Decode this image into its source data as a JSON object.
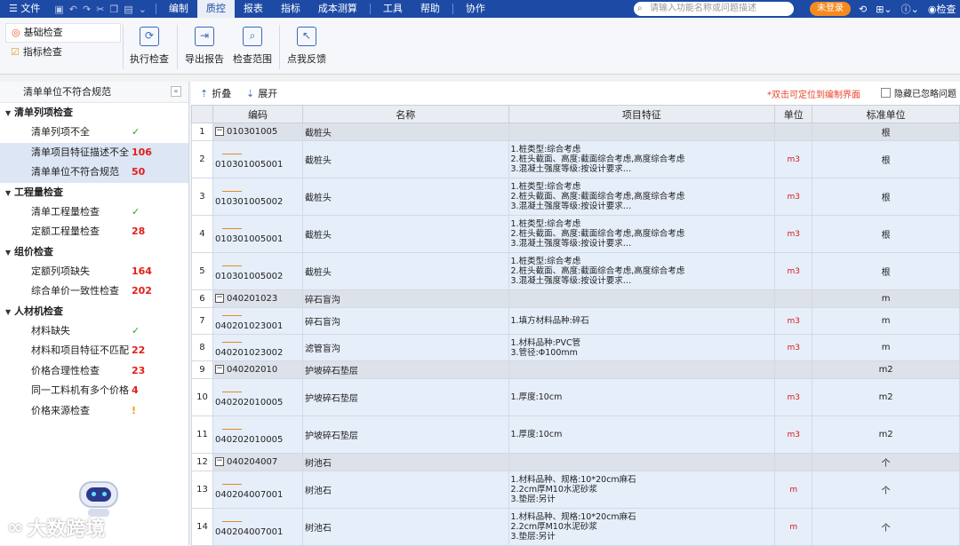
{
  "menu": {
    "file": "文件",
    "edit": "编制",
    "qc": "质控",
    "report": "报表",
    "index": "指标",
    "cost": "成本测算",
    "tools": "工具",
    "help": "帮助",
    "collab": "协作"
  },
  "search": {
    "placeholder": "请输入功能名称或问题描述"
  },
  "login": "未登录",
  "right_tool": "检查",
  "ribbon": {
    "tabs": [
      "基础检查",
      "指标检查"
    ],
    "buttons": [
      "执行检查",
      "导出报告",
      "检查范围",
      "点我反馈"
    ]
  },
  "left": {
    "header": "清单单位不符合规范",
    "groups": [
      {
        "title": "清单列项检查",
        "items": [
          {
            "label": "清单列项不全",
            "value": "✓",
            "type": "ok"
          },
          {
            "label": "清单项目特征描述不全",
            "value": "106",
            "type": "err"
          },
          {
            "label": "清单单位不符合规范",
            "value": "50",
            "type": "err"
          }
        ]
      },
      {
        "title": "工程量检查",
        "items": [
          {
            "label": "清单工程量检查",
            "value": "✓",
            "type": "ok"
          },
          {
            "label": "定额工程量检查",
            "value": "28",
            "type": "err"
          }
        ]
      },
      {
        "title": "组价检查",
        "items": [
          {
            "label": "定额列项缺失",
            "value": "164",
            "type": "err"
          },
          {
            "label": "综合单价一致性检查",
            "value": "202",
            "type": "err"
          }
        ]
      },
      {
        "title": "人材机检查",
        "items": [
          {
            "label": "材料缺失",
            "value": "✓",
            "type": "ok"
          },
          {
            "label": "材料和项目特征不匹配",
            "value": "22",
            "type": "err"
          },
          {
            "label": "价格合理性检查",
            "value": "23",
            "type": "err"
          },
          {
            "label": "同一工料机有多个价格",
            "value": "4",
            "type": "err"
          },
          {
            "label": "价格来源检查",
            "value": "!",
            "type": "warn"
          }
        ]
      }
    ]
  },
  "watermark": "大数跨境",
  "toolbar": {
    "fold": "折叠",
    "expand": "展开",
    "hint": "*双击可定位到编制界面",
    "hide": "隐藏已忽略问题"
  },
  "table": {
    "headers": [
      "编码",
      "名称",
      "项目特征",
      "单位",
      "标准单位"
    ],
    "rows": [
      {
        "n": "1",
        "kind": "parent",
        "code": "010301005",
        "name": "截桩头",
        "feat": "",
        "unit": "",
        "std": "根"
      },
      {
        "n": "2",
        "kind": "child",
        "code": "010301005001",
        "name": "截桩头",
        "feat": "1.桩类型:综合考虑\n2.桩头截面、高度:截面综合考虑,高度综合考虑\n3.混凝土强度等级:按设计要求…",
        "unit": "m3",
        "std": "根"
      },
      {
        "n": "3",
        "kind": "child",
        "code": "010301005002",
        "name": "截桩头",
        "feat": "1.桩类型:综合考虑\n2.桩头截面、高度:截面综合考虑,高度综合考虑\n3.混凝土强度等级:按设计要求…",
        "unit": "m3",
        "std": "根"
      },
      {
        "n": "4",
        "kind": "child",
        "code": "010301005001",
        "name": "截桩头",
        "feat": "1.桩类型:综合考虑\n2.桩头截面、高度:截面综合考虑,高度综合考虑\n3.混凝土强度等级:按设计要求…",
        "unit": "m3",
        "std": "根"
      },
      {
        "n": "5",
        "kind": "child",
        "code": "010301005002",
        "name": "截桩头",
        "feat": "1.桩类型:综合考虑\n2.桩头截面、高度:截面综合考虑,高度综合考虑\n3.混凝土强度等级:按设计要求…",
        "unit": "m3",
        "std": "根"
      },
      {
        "n": "6",
        "kind": "parent",
        "code": "040201023",
        "name": "碎石盲沟",
        "feat": "",
        "unit": "",
        "std": "m"
      },
      {
        "n": "7",
        "kind": "child",
        "code": "040201023001",
        "name": "碎石盲沟",
        "feat": "1.填方材料品种:碎石",
        "unit": "m3",
        "std": "m"
      },
      {
        "n": "8",
        "kind": "child",
        "code": "040201023002",
        "name": "滤管盲沟",
        "feat": "1.材料品种:PVC管\n3.管径:Φ100mm",
        "unit": "m3",
        "std": "m"
      },
      {
        "n": "9",
        "kind": "parent",
        "code": "040202010",
        "name": "护坡碎石垫层",
        "feat": "",
        "unit": "",
        "std": "m2"
      },
      {
        "n": "10",
        "kind": "child",
        "code": "040202010005",
        "name": "护坡碎石垫层",
        "feat": "1.厚度:10cm",
        "unit": "m3",
        "std": "m2"
      },
      {
        "n": "11",
        "kind": "child",
        "code": "040202010005",
        "name": "护坡碎石垫层",
        "feat": "1.厚度:10cm",
        "unit": "m3",
        "std": "m2"
      },
      {
        "n": "12",
        "kind": "parent",
        "code": "040204007",
        "name": "树池石",
        "feat": "",
        "unit": "",
        "std": "个"
      },
      {
        "n": "13",
        "kind": "child",
        "code": "040204007001",
        "name": "树池石",
        "feat": "1.材料品种、规格:10*20cm麻石\n2.2cm厚M10水泥砂浆\n3.垫层:另计",
        "unit": "m",
        "std": "个"
      },
      {
        "n": "14",
        "kind": "child",
        "code": "040204007001",
        "name": "树池石",
        "feat": "1.材料品种、规格:10*20cm麻石\n2.2cm厚M10水泥砂浆\n3.垫层:另计",
        "unit": "m",
        "std": "个"
      }
    ]
  }
}
